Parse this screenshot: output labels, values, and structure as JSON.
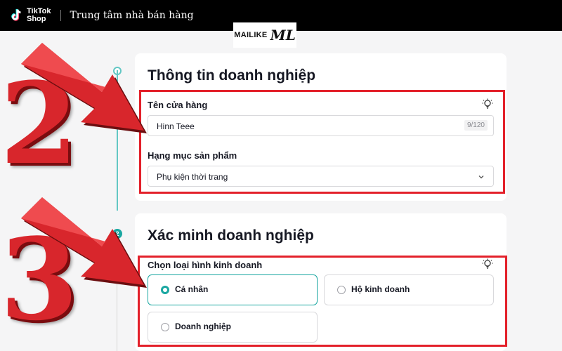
{
  "topbar": {
    "logo_line1": "TikTok",
    "logo_line2": "Shop",
    "title": "Trung tâm nhà bán hàng"
  },
  "watermark": {
    "text": "MAILIKE",
    "glyph": "ML"
  },
  "stepper": {
    "step_number": "2"
  },
  "business_info": {
    "title": "Thông tin doanh nghiệp",
    "store_name_label": "Tên cửa hàng",
    "store_name_value": "Hinn Teee",
    "store_name_counter": "9/120",
    "category_label": "Hạng mục sản phẩm",
    "category_value": "Phụ kiện thời trang"
  },
  "business_verification": {
    "title": "Xác minh doanh nghiệp",
    "type_label": "Chọn loại hình kinh doanh",
    "options": [
      {
        "label": "Cá nhân",
        "selected": true
      },
      {
        "label": "Hộ kinh doanh",
        "selected": false
      },
      {
        "label": "Doanh nghiệp",
        "selected": false
      }
    ]
  },
  "annotations": {
    "number_a": "2",
    "number_b": "3"
  },
  "colors": {
    "accent": "#1aa7a1",
    "highlight": "#e3202a",
    "annotation_red": "#d8262c"
  },
  "icons": {
    "bulb": "lightbulb-icon",
    "chevron": "chevron-down-icon",
    "arrow": "red-arrow-icon"
  }
}
